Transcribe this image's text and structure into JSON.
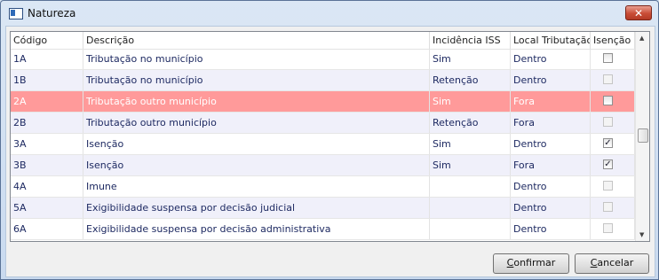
{
  "window": {
    "title": "Natureza",
    "close_glyph": "✕"
  },
  "columns": [
    "Código",
    "Descrição",
    "Incidência ISS",
    "Local Tributação",
    "Isenção"
  ],
  "rows": [
    {
      "codigo": "1A",
      "descricao": "Tributação no município",
      "incidencia": "Sim",
      "local": "Dentro",
      "isencao": false
    },
    {
      "codigo": "1B",
      "descricao": "Tributação no município",
      "incidencia": "Retenção",
      "local": "Dentro",
      "isencao": false
    },
    {
      "codigo": "2A",
      "descricao": "Tributação outro município",
      "incidencia": "Sim",
      "local": "Fora",
      "isencao": false,
      "selected": true
    },
    {
      "codigo": "2B",
      "descricao": "Tributação outro município",
      "incidencia": "Retenção",
      "local": "Fora",
      "isencao": false
    },
    {
      "codigo": "3A",
      "descricao": "Isenção",
      "incidencia": "Sim",
      "local": "Dentro",
      "isencao": true
    },
    {
      "codigo": "3B",
      "descricao": "Isenção",
      "incidencia": "Sim",
      "local": "Fora",
      "isencao": true
    },
    {
      "codigo": "4A",
      "descricao": "Imune",
      "incidencia": "",
      "local": "Dentro",
      "isencao": false
    },
    {
      "codigo": "5A",
      "descricao": "Exigibilidade suspensa por decisão judicial",
      "incidencia": "",
      "local": "Dentro",
      "isencao": false
    },
    {
      "codigo": "6A",
      "descricao": "Exigibilidade suspensa por decisão administrativa",
      "incidencia": "",
      "local": "Dentro",
      "isencao": false
    }
  ],
  "buttons": {
    "confirm_first": "C",
    "confirm_rest": "onfirmar",
    "cancel_first": "C",
    "cancel_rest": "ancelar"
  },
  "scroll": {
    "up": "▲",
    "down": "▼"
  },
  "check_glyph": "✓",
  "colors": {
    "selected_row": "#ff9a9a",
    "alt_row": "#f0f0fa",
    "text": "#1e2a62"
  }
}
